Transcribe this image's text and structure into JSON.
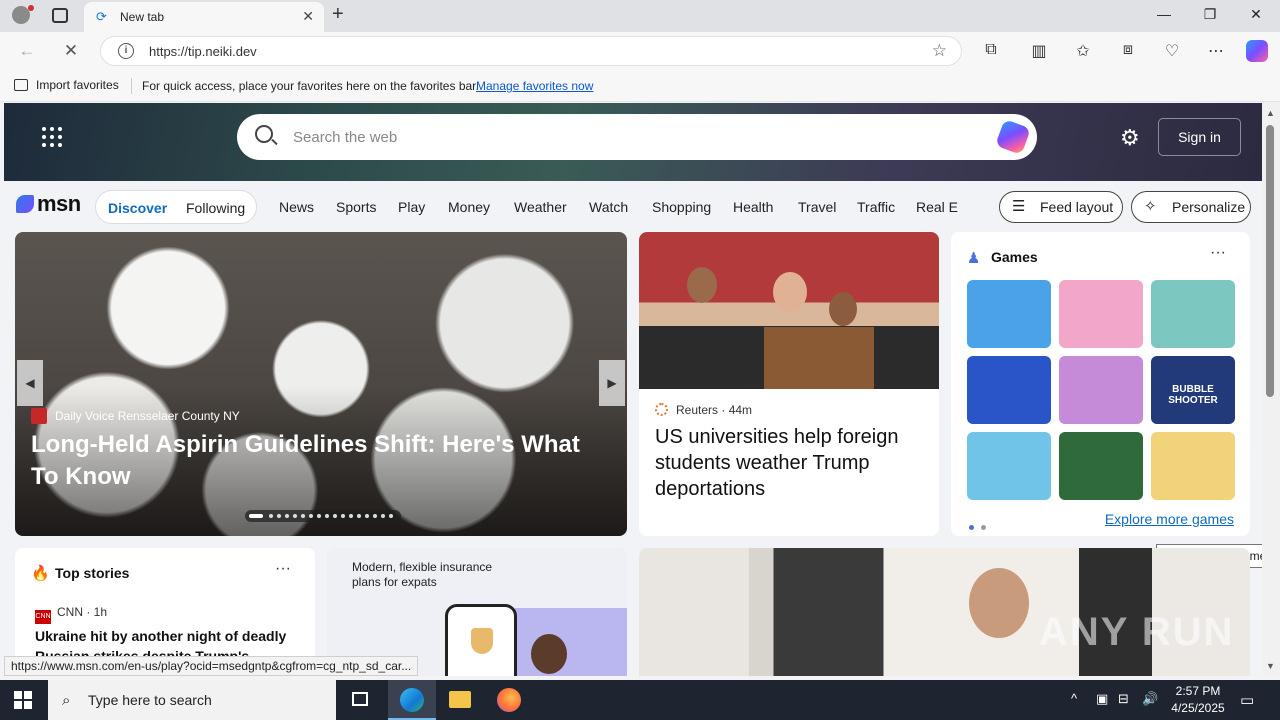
{
  "browser": {
    "tab_title": "New tab",
    "url": "https://tip.neiki.dev",
    "favorites_bar": {
      "import_label": "Import favorites",
      "hint": "For quick access, place your favorites here on the favorites bar.",
      "manage_link": "Manage favorites now"
    },
    "status_url": "https://www.msn.com/en-us/play?ocid=msedgntp&cgfrom=cg_ntp_sd_car..."
  },
  "msn": {
    "search_placeholder": "Search the web",
    "sign_in": "Sign in",
    "logo": "msn",
    "tabs": [
      "Discover",
      "Following"
    ],
    "nav_links": [
      "News",
      "Sports",
      "Play",
      "Money",
      "Weather",
      "Watch",
      "Shopping",
      "Health",
      "Travel",
      "Traffic",
      "Real E"
    ],
    "feed_layout": "Feed layout",
    "personalize": "Personalize",
    "hero": {
      "source": "Daily Voice Rensselaer County NY",
      "title": "Long-Held Aspirin Guidelines Shift: Here's What To Know"
    },
    "reuters": {
      "source": "Reuters",
      "age": "44m",
      "title": "US universities help foreign students weather Trump deportations"
    },
    "games": {
      "title": "Games",
      "explore": "Explore more games",
      "tooltip": "Explore more games",
      "tiles": [
        {
          "name": "restaurant-game",
          "color": "#4aa3e8"
        },
        {
          "name": "dress-up-game",
          "color": "#f2a7c9"
        },
        {
          "name": "story-game",
          "color": "#7cc7c0"
        },
        {
          "name": "block-puzzle-game",
          "color": "#2a55c8"
        },
        {
          "name": "makeup-game",
          "color": "#c58ad8"
        },
        {
          "name": "bubble-shooter-game",
          "color": "#233a7a"
        },
        {
          "name": "foot-doctor-game",
          "color": "#6fc4e8"
        },
        {
          "name": "mahjong-game",
          "color": "#2f6b3a"
        },
        {
          "name": "cat-puzzle-game",
          "color": "#f2d37a"
        }
      ],
      "bubble_label": "BUBBLE SHOOTER"
    },
    "top_stories": {
      "title": "Top stories",
      "source": "CNN",
      "age": "1h",
      "headline": "Ukraine hit by another night of deadly Russian strikes despite Trump's 'Vladimi"
    },
    "ad": {
      "text": "Modern, flexible insurance plans for expats"
    },
    "watermark": "ANY RUN"
  },
  "taskbar": {
    "search_placeholder": "Type here to search",
    "time": "2:57 PM",
    "date": "4/25/2025"
  }
}
